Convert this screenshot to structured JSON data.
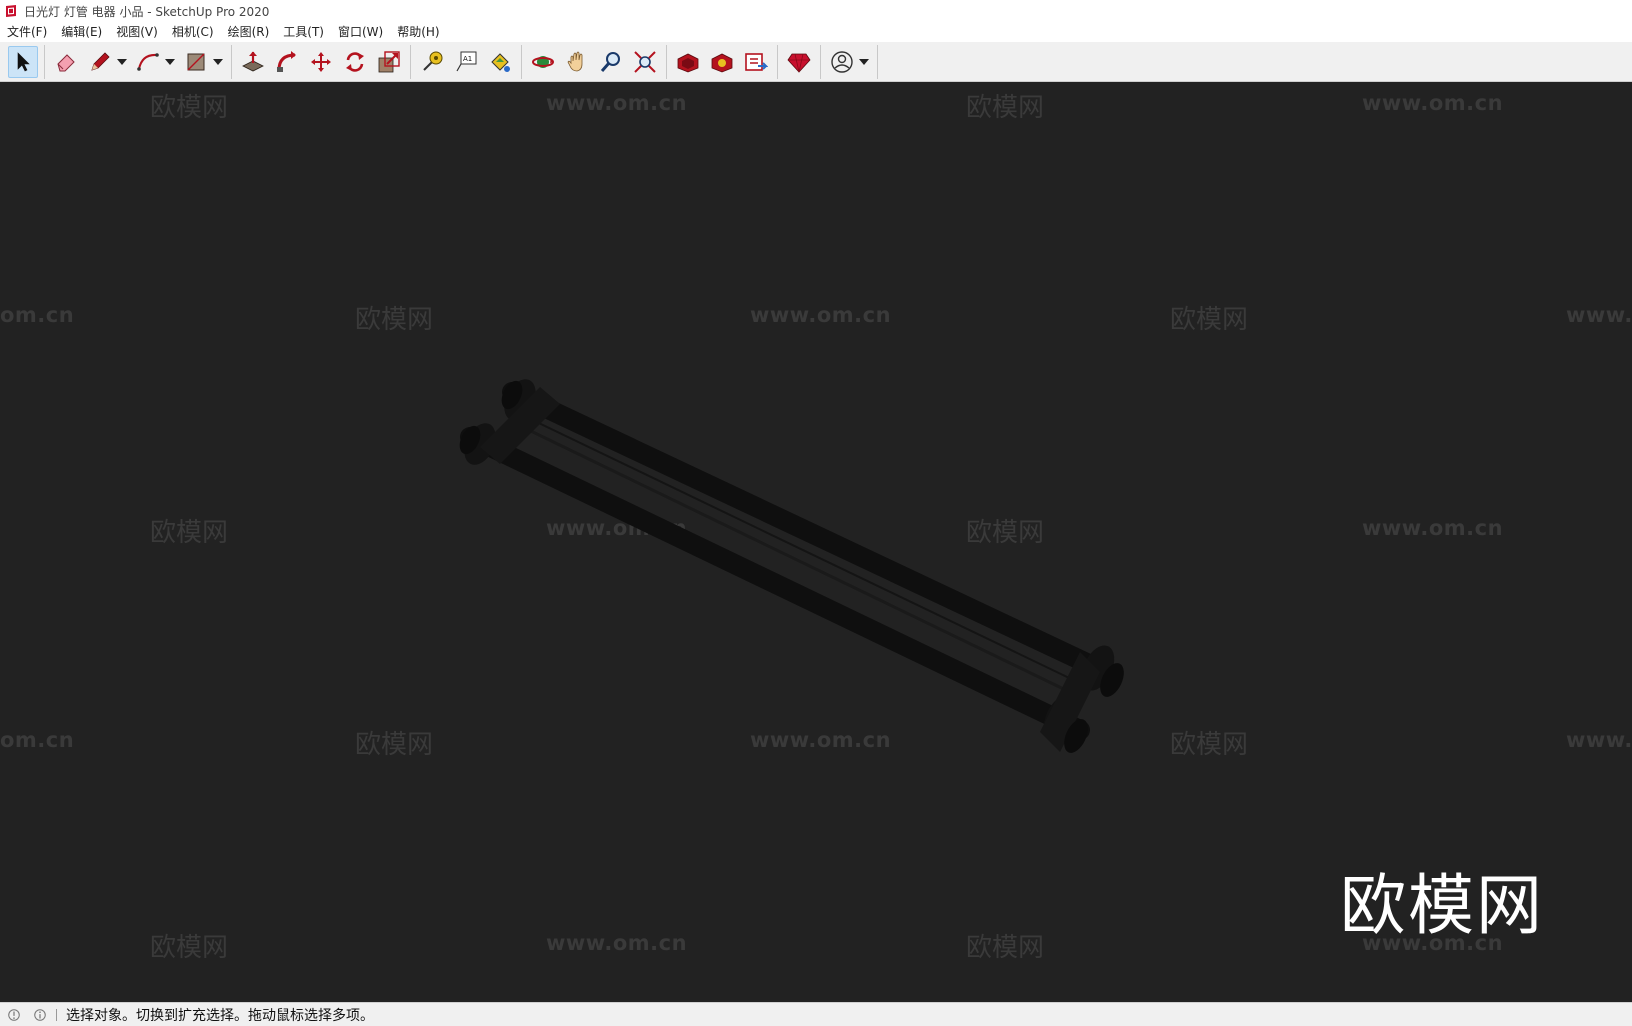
{
  "window": {
    "title": "日光灯 灯管 电器 小品 - SketchUp Pro 2020"
  },
  "menu": {
    "items": [
      {
        "label": "文件(F)"
      },
      {
        "label": "编辑(E)"
      },
      {
        "label": "视图(V)"
      },
      {
        "label": "相机(C)"
      },
      {
        "label": "绘图(R)"
      },
      {
        "label": "工具(T)"
      },
      {
        "label": "窗口(W)"
      },
      {
        "label": "帮助(H)"
      }
    ]
  },
  "toolbar": {
    "tools": [
      {
        "icon": "select-arrow-icon",
        "active": true
      },
      {
        "icon": "eraser-icon"
      },
      {
        "icon": "pencil-line-icon"
      },
      {
        "icon": "arc-icon"
      },
      {
        "icon": "rectangle-shape-icon"
      },
      {
        "icon": "push-pull-icon"
      },
      {
        "icon": "follow-me-icon"
      },
      {
        "icon": "move-icon"
      },
      {
        "icon": "rotate-icon"
      },
      {
        "icon": "scale-icon"
      },
      {
        "icon": "tape-measure-icon"
      },
      {
        "icon": "text-label-icon"
      },
      {
        "icon": "paint-bucket-icon"
      },
      {
        "icon": "orbit-icon"
      },
      {
        "icon": "pan-hand-icon"
      },
      {
        "icon": "zoom-icon"
      },
      {
        "icon": "zoom-extents-icon"
      },
      {
        "icon": "3d-warehouse-icon"
      },
      {
        "icon": "extension-warehouse-icon"
      },
      {
        "icon": "layout-send-icon"
      },
      {
        "icon": "extension-manager-ruby-icon"
      },
      {
        "icon": "account-user-icon"
      }
    ]
  },
  "watermarks": {
    "brand": "欧模网",
    "url": "www.om.cn",
    "url_partial_left": "om.cn",
    "url_partial_right": "www."
  },
  "viewport": {
    "background_color": "#222222",
    "model_description": "fluorescent light tube fixture (two tubes)"
  },
  "status": {
    "text": "选择对象。切换到扩充选择。拖动鼠标选择多项。"
  },
  "colors": {
    "accent": "#cce4f7",
    "sketchup_red": "#c8102e"
  }
}
